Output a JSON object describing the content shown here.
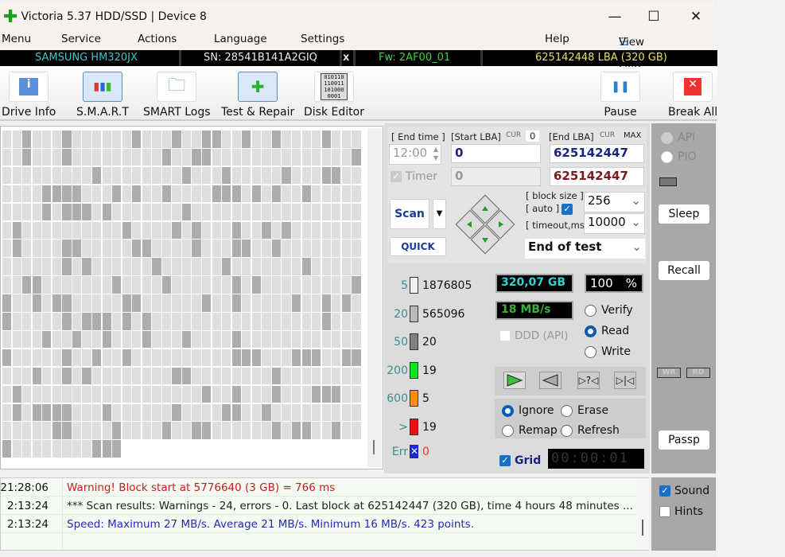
{
  "window": {
    "title": "Victoria 5.37 HDD/SSD | Device 8"
  },
  "menu": {
    "items": [
      "Menu",
      "Service",
      "Actions",
      "Language",
      "Settings",
      "Help"
    ],
    "view_buffer": "View Buffer Live"
  },
  "drive": {
    "model": "SAMSUNG HM320JX",
    "serial": "SN: 28541B141A2GIQ",
    "close": "x",
    "firmware": "Fw: 2AF00_01",
    "capacity": "625142448 LBA (320 GB)"
  },
  "toolbar": {
    "drive_info": "Drive Info",
    "smart": "S.M.A.R.T",
    "smart_logs": "SMART Logs",
    "test_repair": "Test & Repair",
    "disk_editor": "Disk Editor",
    "disk_editor_bits": "010110 110011 101000 0001",
    "pause": "Pause",
    "break_all": "Break All"
  },
  "test": {
    "end_time_label": "[ End time ]",
    "end_time": "12:00",
    "start_lba_label": "[Start LBA]",
    "cur": "CUR",
    "cur_value": "0",
    "end_lba_label": "[End LBA]",
    "max": "MAX",
    "start_lba": "0",
    "end_lba": "625142447",
    "current_lba": "0",
    "end_lba2": "625142447",
    "timer": "Timer",
    "scan": "Scan",
    "quick": "QUICK",
    "block_size_label": "[ block size ]",
    "auto_label": "[ auto ]",
    "timeout_label": "[ timeout,ms ]",
    "block_size": "256",
    "timeout": "10000",
    "end_action": "End of test"
  },
  "stats": {
    "legend": [
      {
        "ms": "5",
        "count": "1876805",
        "color": "#f0f0f0"
      },
      {
        "ms": "20",
        "count": "565096",
        "color": "#b9b9b9"
      },
      {
        "ms": "50",
        "count": "20",
        "color": "#808080"
      },
      {
        "ms": "200",
        "count": "19",
        "color": "#19e019"
      },
      {
        "ms": "600",
        "count": "5",
        "color": "#ff8c19"
      },
      {
        "ms": ">",
        "count": "19",
        "color": "#e81010"
      }
    ],
    "err_label": "Err",
    "err_count": "0",
    "size": "320,07 GB",
    "percent": "100",
    "percent_sign": "%",
    "speed": "18 MB/s",
    "ddd": "DDD (API)",
    "verify": "Verify",
    "read": "Read",
    "write": "Write",
    "ignore": "Ignore",
    "erase": "Erase",
    "remap": "Remap",
    "refresh": "Refresh",
    "grid": "Grid",
    "elapsed": "00:00:01",
    "mode": "Read",
    "action": "Ignore"
  },
  "side": {
    "api": "API",
    "pio": "PIO",
    "sleep": "Sleep",
    "recall": "Recall",
    "wr": "WR",
    "rd": "RD",
    "passp": "Passp"
  },
  "log": [
    {
      "time": "21:28:06",
      "msg": "Warning! Block start at 5776640 (3 GB)  = 766 ms",
      "color": "#c02020"
    },
    {
      "time": "2:13:24",
      "msg": "*** Scan results: Warnings - 24, errors - 0. Last block at 625142447 (320 GB), time 4 hours 48 minutes ...",
      "color": "#222222"
    },
    {
      "time": "2:13:24",
      "msg": "Speed: Maximum 27 MB/s. Average 21 MB/s. Minimum 16 MB/s. 423 points.",
      "color": "#2a2ab0"
    }
  ],
  "options": {
    "sound": "Sound",
    "hints": "Hints",
    "sound_checked": true,
    "hints_checked": false
  }
}
